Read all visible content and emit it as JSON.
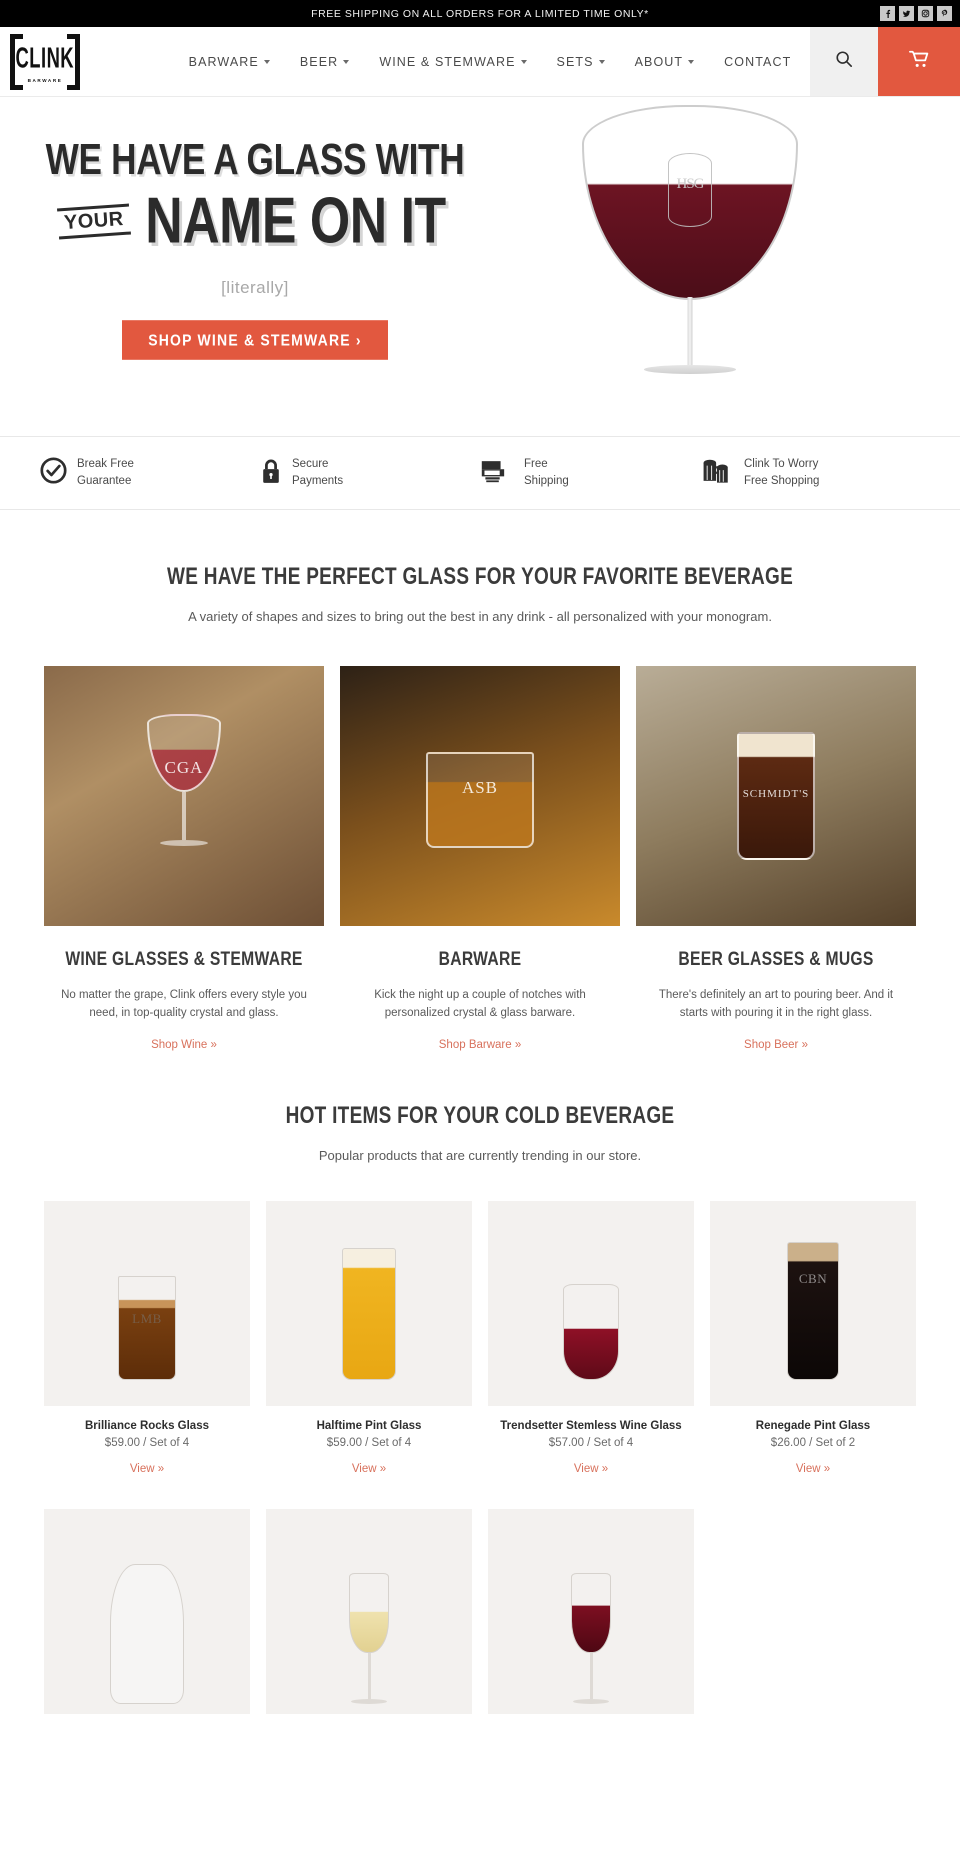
{
  "topbar": {
    "promo": "FREE SHIPPING ON ALL ORDERS FOR A LIMITED TIME ONLY*",
    "social": [
      {
        "name": "facebook-icon",
        "glyph": "f"
      },
      {
        "name": "twitter-icon",
        "glyph": "t"
      },
      {
        "name": "instagram-icon",
        "glyph": "o"
      },
      {
        "name": "pinterest-icon",
        "glyph": "P"
      }
    ]
  },
  "header": {
    "logo_main": "CLINK",
    "logo_sub": "BARWARE",
    "nav": [
      {
        "label": "BARWARE",
        "has_dropdown": true
      },
      {
        "label": "BEER",
        "has_dropdown": true
      },
      {
        "label": "WINE & STEMWARE",
        "has_dropdown": true
      },
      {
        "label": "SETS",
        "has_dropdown": true
      },
      {
        "label": "ABOUT",
        "has_dropdown": true
      },
      {
        "label": "CONTACT",
        "has_dropdown": false
      }
    ],
    "search_icon": "search-icon",
    "cart_icon": "cart-icon",
    "cart_bg": "#e2583f"
  },
  "hero": {
    "line1": "WE HAVE A GLASS WITH",
    "emphasis": "YOUR",
    "line2": "NAME ON IT",
    "subtitle": "[literally]",
    "cta_label": "SHOP WINE & STEMWARE ›",
    "cta_bg": "#e2583f",
    "image_monogram": "HSG"
  },
  "trust": [
    {
      "icon": "check-circle-icon",
      "line1": "Break Free",
      "line2": "Guarantee"
    },
    {
      "icon": "lock-icon",
      "line1": "Secure",
      "line2": "Payments"
    },
    {
      "icon": "truck-icon",
      "line1": "Free",
      "line2": "Shipping"
    },
    {
      "icon": "beer-mugs-icon",
      "line1": "Clink To Worry",
      "line2": "Free Shopping"
    }
  ],
  "categories_section": {
    "heading": "WE HAVE THE PERFECT GLASS FOR YOUR FAVORITE BEVERAGE",
    "subheading": "A variety of shapes and sizes to bring out the best in any drink - all personalized with your monogram.",
    "items": [
      {
        "title": "WINE GLASSES & STEMWARE",
        "desc": "No matter the grape, Clink offers every style you need, in top-quality crystal and glass.",
        "link": "Shop Wine »",
        "monogram": "CGA"
      },
      {
        "title": "BARWARE",
        "desc": "Kick the night up a couple of notches with personalized crystal & glass barware.",
        "link": "Shop Barware »",
        "monogram": "ASB"
      },
      {
        "title": "BEER GLASSES & MUGS",
        "desc": "There's definitely an art to pouring beer. And it starts with pouring it in the right glass.",
        "link": "Shop Beer »",
        "monogram": "SCHMIDT'S"
      }
    ]
  },
  "hot_section": {
    "heading": "HOT ITEMS FOR YOUR COLD BEVERAGE",
    "subheading": "Popular products that are currently trending in our store.",
    "products": [
      {
        "name": "Brilliance Rocks Glass",
        "price": "$59.00 / Set of 4",
        "link": "View »",
        "monogram": "LMB"
      },
      {
        "name": "Halftime Pint Glass",
        "price": "$59.00 / Set of 4",
        "link": "View »",
        "monogram": ""
      },
      {
        "name": "Trendsetter Stemless Wine Glass",
        "price": "$57.00 / Set of 4",
        "link": "View »",
        "monogram": ""
      },
      {
        "name": "Renegade Pint Glass",
        "price": "$26.00 / Set of 2",
        "link": "View »",
        "monogram": "CBN"
      }
    ],
    "products_row2": [
      {
        "name": "",
        "price": "",
        "link": "",
        "monogram": ""
      },
      {
        "name": "",
        "price": "",
        "link": "",
        "monogram": ""
      },
      {
        "name": "",
        "price": "",
        "link": "",
        "monogram": ""
      }
    ]
  },
  "theme": {
    "accent": "#e2583f",
    "link": "#d8715c",
    "text_dark": "#3b3b3b",
    "text_body": "#5a5a5a"
  }
}
